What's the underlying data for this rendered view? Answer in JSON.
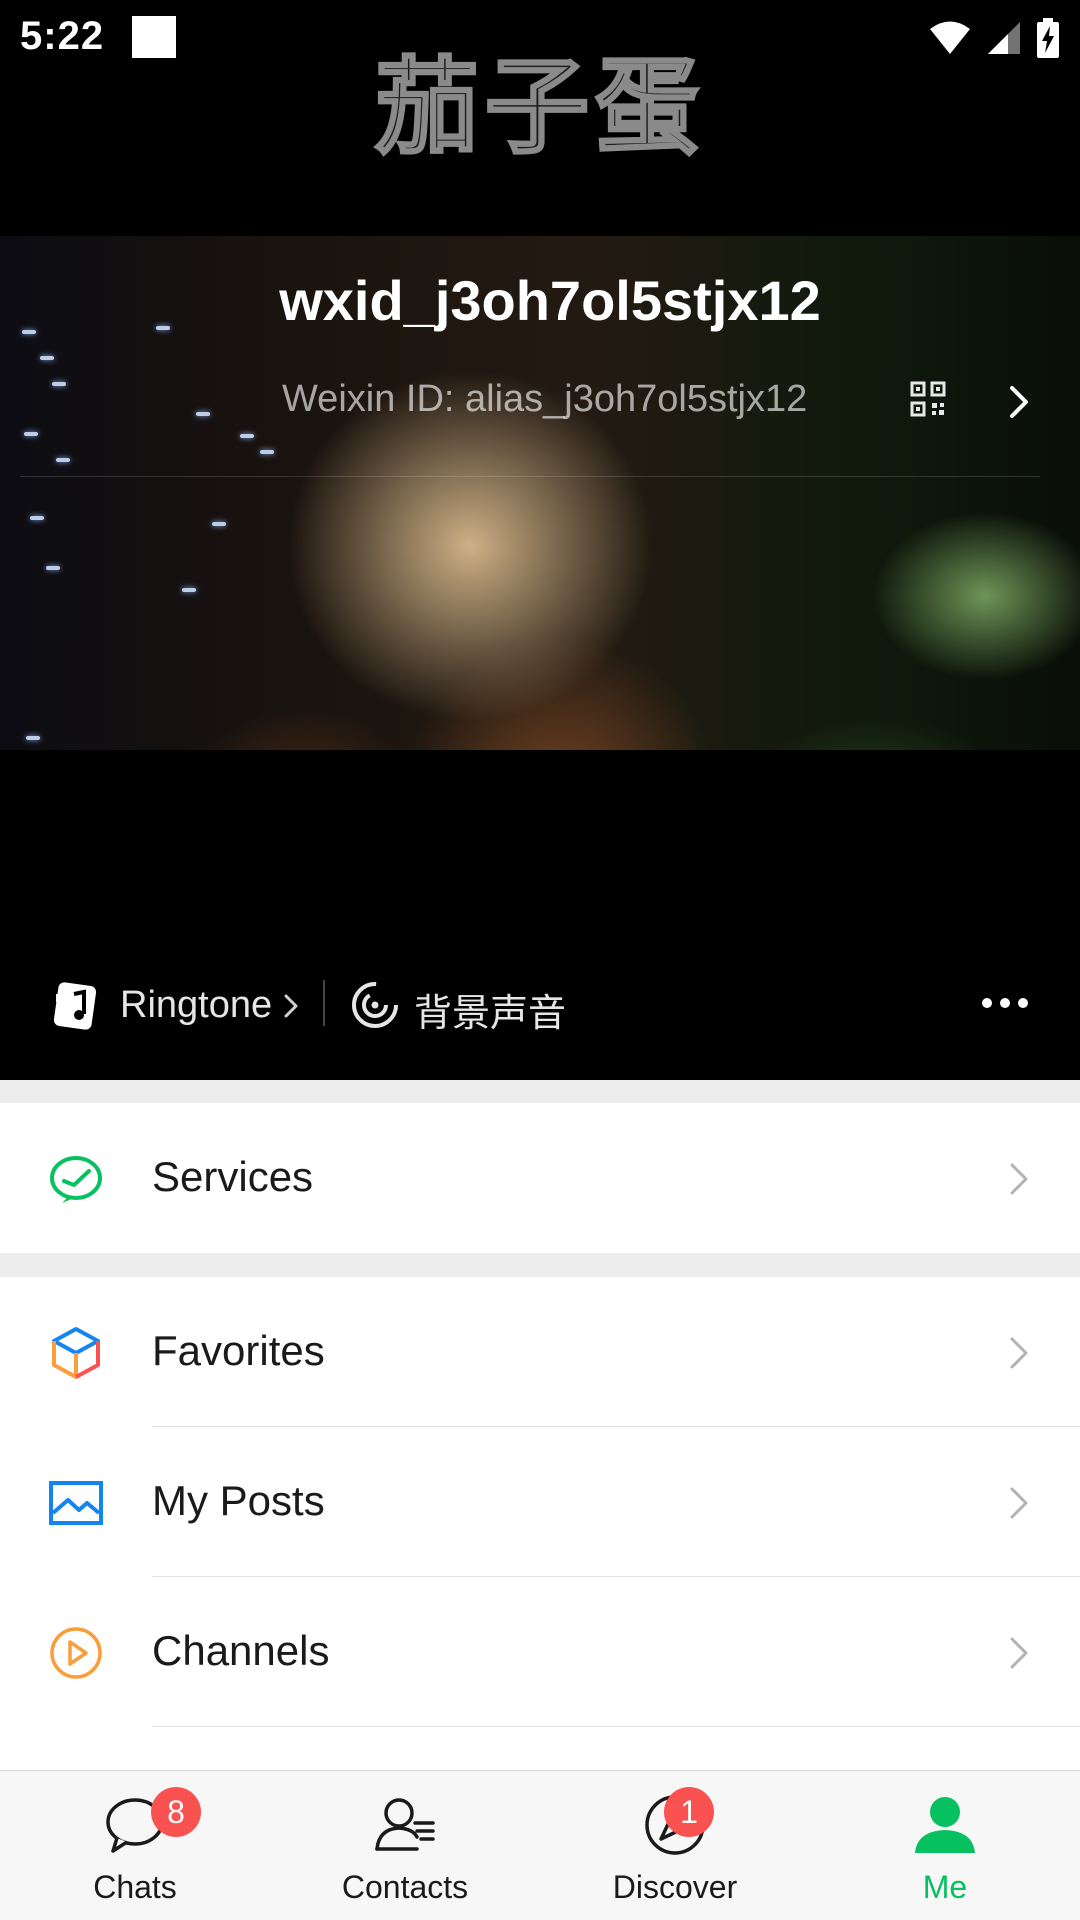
{
  "status_bar": {
    "time": "5:22"
  },
  "cover": {
    "banner_text": "茄子蛋"
  },
  "profile": {
    "name": "wxid_j3oh7ol5stjx12",
    "weixin_id": "Weixin ID: alias_j3oh7ol5stjx12"
  },
  "status_row": {
    "ringtone_label": "Ringtone",
    "background_sound_label": "背景声音"
  },
  "menu": {
    "services": "Services",
    "favorites": "Favorites",
    "my_posts": "My Posts",
    "channels": "Channels"
  },
  "tabs": [
    {
      "label": "Chats",
      "badge": "8",
      "icon": "chat-bubble-icon"
    },
    {
      "label": "Contacts",
      "badge": "",
      "icon": "contacts-icon"
    },
    {
      "label": "Discover",
      "badge": "1",
      "icon": "compass-icon"
    },
    {
      "label": "Me",
      "badge": "",
      "icon": "person-icon",
      "active": true
    }
  ],
  "colors": {
    "accent": "#07c160",
    "badge": "#fa5151",
    "services_icon": "#07c160",
    "channels_icon": "#fa9d3b",
    "posts_icon": "#1485ee"
  }
}
